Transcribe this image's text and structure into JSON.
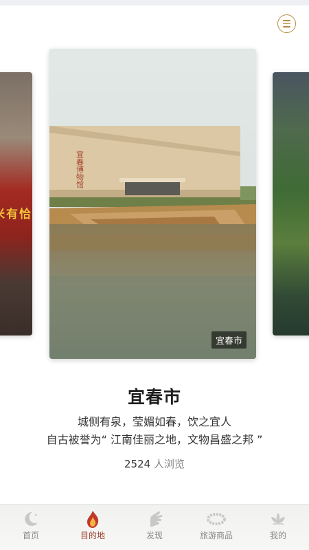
{
  "header": {
    "menu_icon": "menu-icon"
  },
  "carousel": {
    "left_card_sign": "米有恰",
    "active_card": {
      "tag": "宜春市",
      "building_sign": "宜春博物馆"
    }
  },
  "destination": {
    "title": "宜春市",
    "desc_line1": "城侧有泉，莹媚如春，饮之宜人",
    "desc_line2": "自古被誉为“ 江南佳丽之地，文物昌盛之邦 ”",
    "view_count": "2524",
    "view_suffix": " 人浏览"
  },
  "tabbar": {
    "active_color": "#9b3b2b",
    "items": [
      {
        "label": "首页",
        "icon": "moon-icon"
      },
      {
        "label": "目的地",
        "icon": "flame-icon"
      },
      {
        "label": "发现",
        "icon": "hand-icon"
      },
      {
        "label": "旅游商品",
        "icon": "bead-bracelet-icon"
      },
      {
        "label": "我的",
        "icon": "lotus-icon"
      }
    ]
  }
}
